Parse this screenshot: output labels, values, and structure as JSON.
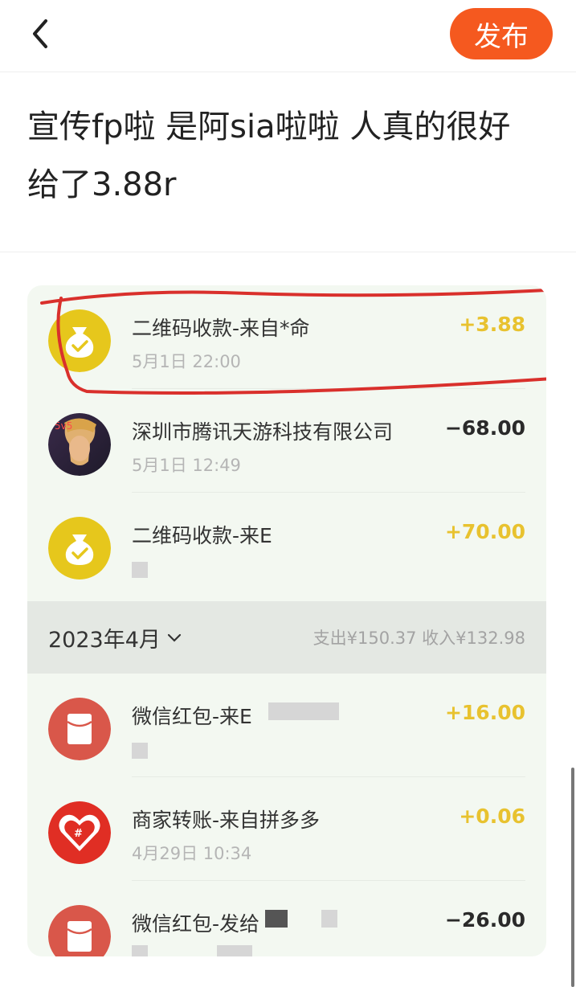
{
  "header": {
    "publish_label": "发布"
  },
  "post": {
    "text": "宣传fp啦 是阿sia啦啦 人真的很好 给了3.88r"
  },
  "screenshot": {
    "transactions_top": [
      {
        "title": "二维码收款-来自*命",
        "time": "5月1日 22:00",
        "amount": "+3.88",
        "icon": "money-bag-icon"
      },
      {
        "title": "深圳市腾讯天游科技有限公司",
        "time": "5月1日 12:49",
        "amount": "−68.00",
        "icon": "game-avatar"
      },
      {
        "title": "二维码收款-来E",
        "time": "",
        "amount": "+70.00",
        "icon": "money-bag-icon"
      }
    ],
    "month": {
      "label": "2023年4月",
      "stats": "支出¥150.37  收入¥132.98"
    },
    "transactions_bottom": [
      {
        "title": "微信红包-来E",
        "time": "",
        "amount": "+16.00",
        "icon": "red-packet-icon"
      },
      {
        "title": "商家转账-来自拼多多",
        "time": "4月29日 10:34",
        "amount": "+0.06",
        "icon": "pinduoduo-icon"
      },
      {
        "title": "微信红包-发给",
        "time": "",
        "amount": "−26.00",
        "icon": "red-packet-icon"
      }
    ],
    "colors": {
      "income": "#e8c22f",
      "expense": "#2a2a2a",
      "publish": "#f5591f",
      "highlight_ink": "#d9302c"
    }
  }
}
